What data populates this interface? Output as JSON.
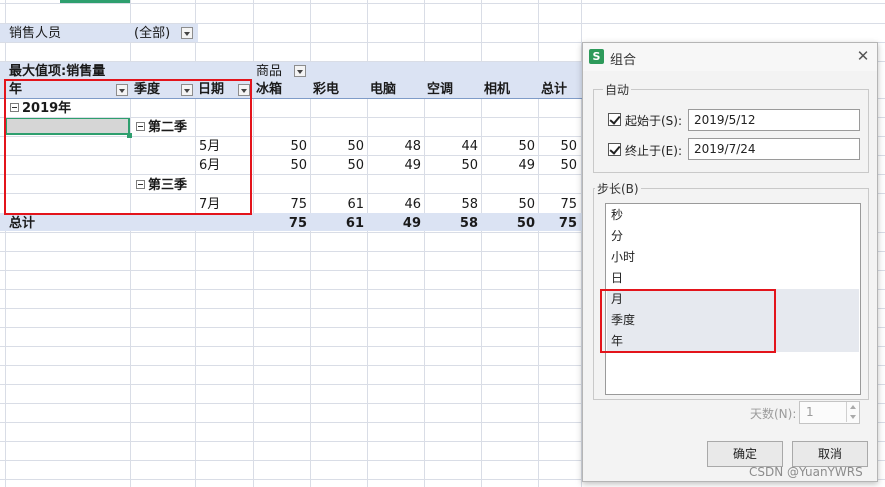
{
  "sheet": {
    "filter_label": "销售人员",
    "filter_value": "(全部)",
    "value_field": "最大值项:销售量",
    "column_field": "商品",
    "row_headers": [
      "年",
      "季度",
      "日期"
    ],
    "product_columns": [
      "冰箱",
      "彩电",
      "电脑",
      "空调",
      "相机",
      "总计"
    ],
    "year": "2019年",
    "quarter_2": "第二季",
    "quarter_3": "第三季",
    "rows": [
      {
        "month": "5月",
        "values": [
          "50",
          "50",
          "48",
          "44",
          "50",
          "50"
        ]
      },
      {
        "month": "6月",
        "values": [
          "50",
          "50",
          "49",
          "50",
          "49",
          "50"
        ]
      },
      {
        "month": "7月",
        "values": [
          "75",
          "61",
          "46",
          "58",
          "50",
          "75"
        ]
      }
    ],
    "total_label": "总计",
    "total_values": [
      "75",
      "61",
      "49",
      "58",
      "50",
      "75"
    ]
  },
  "dialog": {
    "title": "组合",
    "auto_label": "自动",
    "start_label": "起始于(S):",
    "start_value": "2019/5/12",
    "end_label": "终止于(E):",
    "end_value": "2019/7/24",
    "step_label": "步长(B)",
    "step_items": [
      "秒",
      "分",
      "小时",
      "日",
      "月",
      "季度",
      "年"
    ],
    "days_label": "天数(N):",
    "days_value": "1",
    "ok_label": "确定",
    "cancel_label": "取消"
  },
  "watermark": "CSDN @YuanYWRS",
  "colors": {
    "header_band": "#dbe3f3",
    "selection_green": "#2e9f6e",
    "highlight_red": "#e3141b",
    "list_selected": "#e6e9ef"
  }
}
